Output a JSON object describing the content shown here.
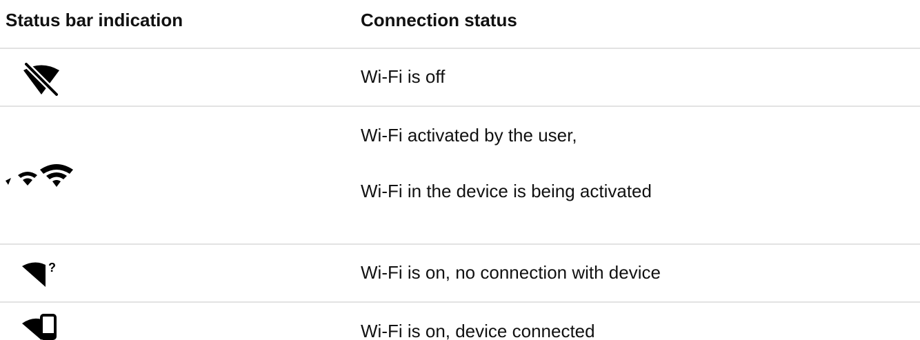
{
  "table": {
    "headers": {
      "indication": "Status bar indication",
      "status": "Connection status"
    },
    "rows": [
      {
        "icon": "wifi-off-icon",
        "status": "Wi-Fi is off"
      },
      {
        "icon": "wifi-activating-icon",
        "status_lines": [
          "Wi-Fi activated by the user,",
          "Wi-Fi in the device is being activated"
        ]
      },
      {
        "icon": "wifi-no-connection-icon",
        "status": "Wi-Fi is on, no connection with device"
      },
      {
        "icon": "wifi-device-connected-icon",
        "status": "Wi-Fi is on, device connected"
      }
    ]
  },
  "colors": {
    "text": "#111111",
    "divider": "#e2e2e2",
    "icon": "#000000"
  }
}
